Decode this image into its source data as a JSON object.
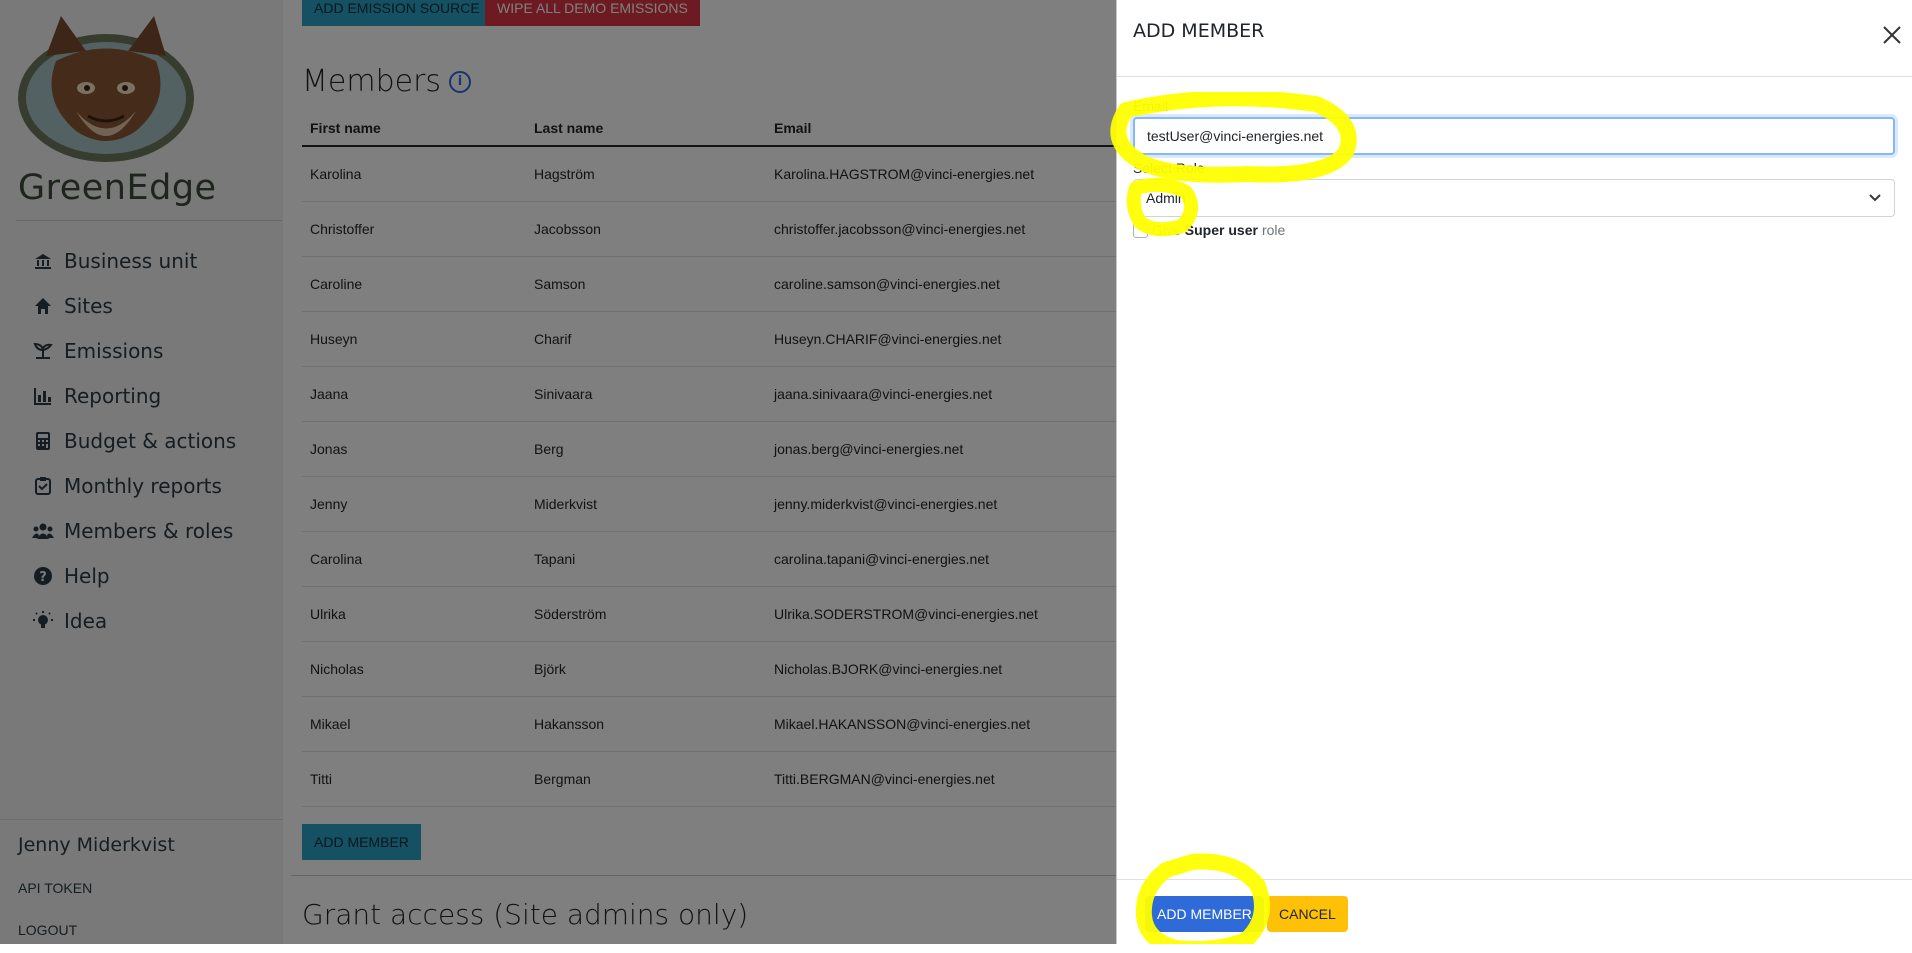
{
  "sidebar": {
    "brand": "GreenEdge",
    "nav": [
      {
        "label": "Business unit",
        "icon": "bank-icon"
      },
      {
        "label": "Sites",
        "icon": "home-icon"
      },
      {
        "label": "Emissions",
        "icon": "plant-icon"
      },
      {
        "label": "Reporting",
        "icon": "bar-chart-icon"
      },
      {
        "label": "Budget & actions",
        "icon": "calculator-icon"
      },
      {
        "label": "Monthly reports",
        "icon": "clipboard-icon"
      },
      {
        "label": "Members & roles",
        "icon": "people-icon"
      },
      {
        "label": "Help",
        "icon": "question-icon"
      },
      {
        "label": "Idea",
        "icon": "lightbulb-icon"
      }
    ],
    "user_name": "Jenny Miderkvist",
    "api_token": "API TOKEN",
    "logout": "LOGOUT"
  },
  "main": {
    "add_emission_source": "ADD EMISSION SOURCE",
    "wipe_demo": "WIPE ALL DEMO EMISSIONS",
    "members_title": "Members",
    "columns": [
      "First name",
      "Last name",
      "Email"
    ],
    "rows": [
      [
        "Karolina",
        "Hagström",
        "Karolina.HAGSTROM@vinci-energies.net"
      ],
      [
        "Christoffer",
        "Jacobsson",
        "christoffer.jacobsson@vinci-energies.net"
      ],
      [
        "Caroline",
        "Samson",
        "caroline.samson@vinci-energies.net"
      ],
      [
        "Huseyn",
        "Charif",
        "Huseyn.CHARIF@vinci-energies.net"
      ],
      [
        "Jaana",
        "Sinivaara",
        "jaana.sinivaara@vinci-energies.net"
      ],
      [
        "Jonas",
        "Berg",
        "jonas.berg@vinci-energies.net"
      ],
      [
        "Jenny",
        "Miderkvist",
        "jenny.miderkvist@vinci-energies.net"
      ],
      [
        "Carolina",
        "Tapani",
        "carolina.tapani@vinci-energies.net"
      ],
      [
        "Ulrika",
        "Söderström",
        "Ulrika.SODERSTROM@vinci-energies.net"
      ],
      [
        "Nicholas",
        "Björk",
        "Nicholas.BJORK@vinci-energies.net"
      ],
      [
        "Mikael",
        "Hakansson",
        "Mikael.HAKANSSON@vinci-energies.net"
      ],
      [
        "Titti",
        "Bergman",
        "Titti.BERGMAN@vinci-energies.net"
      ]
    ],
    "add_member": "ADD MEMBER",
    "grant_title": "Grant access (Site admins only)"
  },
  "panel": {
    "title": "ADD MEMBER",
    "email_label": "Email",
    "email_value": "testUser@vinci-energies.net",
    "role_label": "Select Role",
    "role_value": "Admin",
    "super_give": "Give",
    "super_bold": "Super user",
    "super_role": "role",
    "super_checked": false,
    "add_button": "ADD MEMBER",
    "cancel_button": "CANCEL"
  },
  "colors": {
    "highlight": "#ffff00",
    "primary": "#2f6ad9",
    "warning": "#ffc107",
    "info": "#2aa2c4",
    "danger": "#dc3545"
  }
}
